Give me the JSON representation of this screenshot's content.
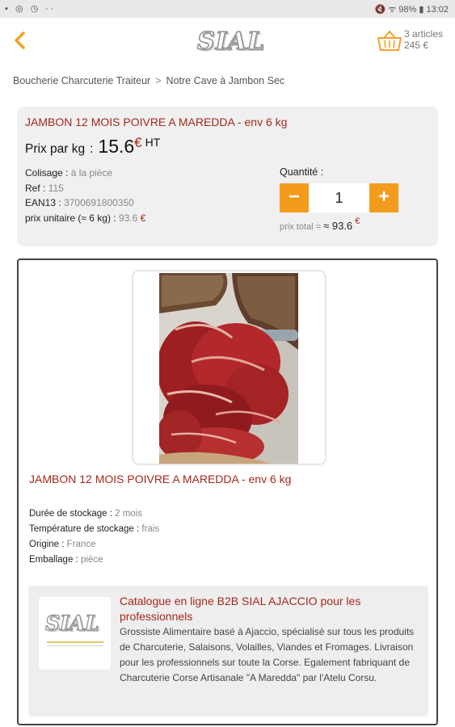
{
  "status_bar": {
    "left_icons": "▪ ◎ ◷  ··",
    "right_text": "🔇 ᯤ 98% ▮ 13:02"
  },
  "header": {
    "logo": "SIAL",
    "cart_count": "3 articles",
    "cart_total": "245 €"
  },
  "breadcrumb": {
    "items": [
      "Boucherie Charcuterie Traiteur",
      "Notre Cave à Jambon Sec"
    ],
    "separator": ">"
  },
  "product": {
    "title": "JAMBON 12 MOIS POIVRE A MAREDDA - env 6 kg",
    "price_label": "Prix par kg",
    "price_value": "15.6",
    "currency": "€",
    "price_suffix": "HT",
    "colisage_label": "Colisage :",
    "colisage_value": "à la pièce",
    "ref_label": "Ref :",
    "ref_value": "115",
    "ean_label": "EAN13 :",
    "ean_value": "3700691800350",
    "unit_label": "prix unitaire (≈ 6 kg) :",
    "unit_value": "93.6",
    "quantity_label": "Quantité :",
    "quantity": "1",
    "total_label": "prix total = ",
    "total_value": "≈ 93.6"
  },
  "detail": {
    "title": "JAMBON 12 MOIS POIVRE A MAREDDA - env 6 kg",
    "storage_label": "Durée de stockage :",
    "storage_value": "2 mois",
    "temp_label": "Température de stockage :",
    "temp_value": "frais",
    "origin_label": "Origine :",
    "origin_value": "France",
    "packaging_label": "Emballage :",
    "packaging_value": "pièce"
  },
  "company": {
    "logo": "SIAL",
    "title": "Catalogue en ligne B2B SIAL AJACCIO pour les professionnels",
    "description": "Grossiste Alimentaire basé à Ajaccio, spécialisé sur tous les produits de Charcuterie, Salaisons, Volailles, Viandes et Fromages. Livraison pour les professionnels sur toute la Corse. Egalement fabriquant de Charcuterie Corse Artisanale \"A Maredda\" par l'Atelu Corsu."
  },
  "colors": {
    "accent": "#f49b1b",
    "title_red": "#a6281d",
    "panel_grey": "#f0f0f0"
  }
}
